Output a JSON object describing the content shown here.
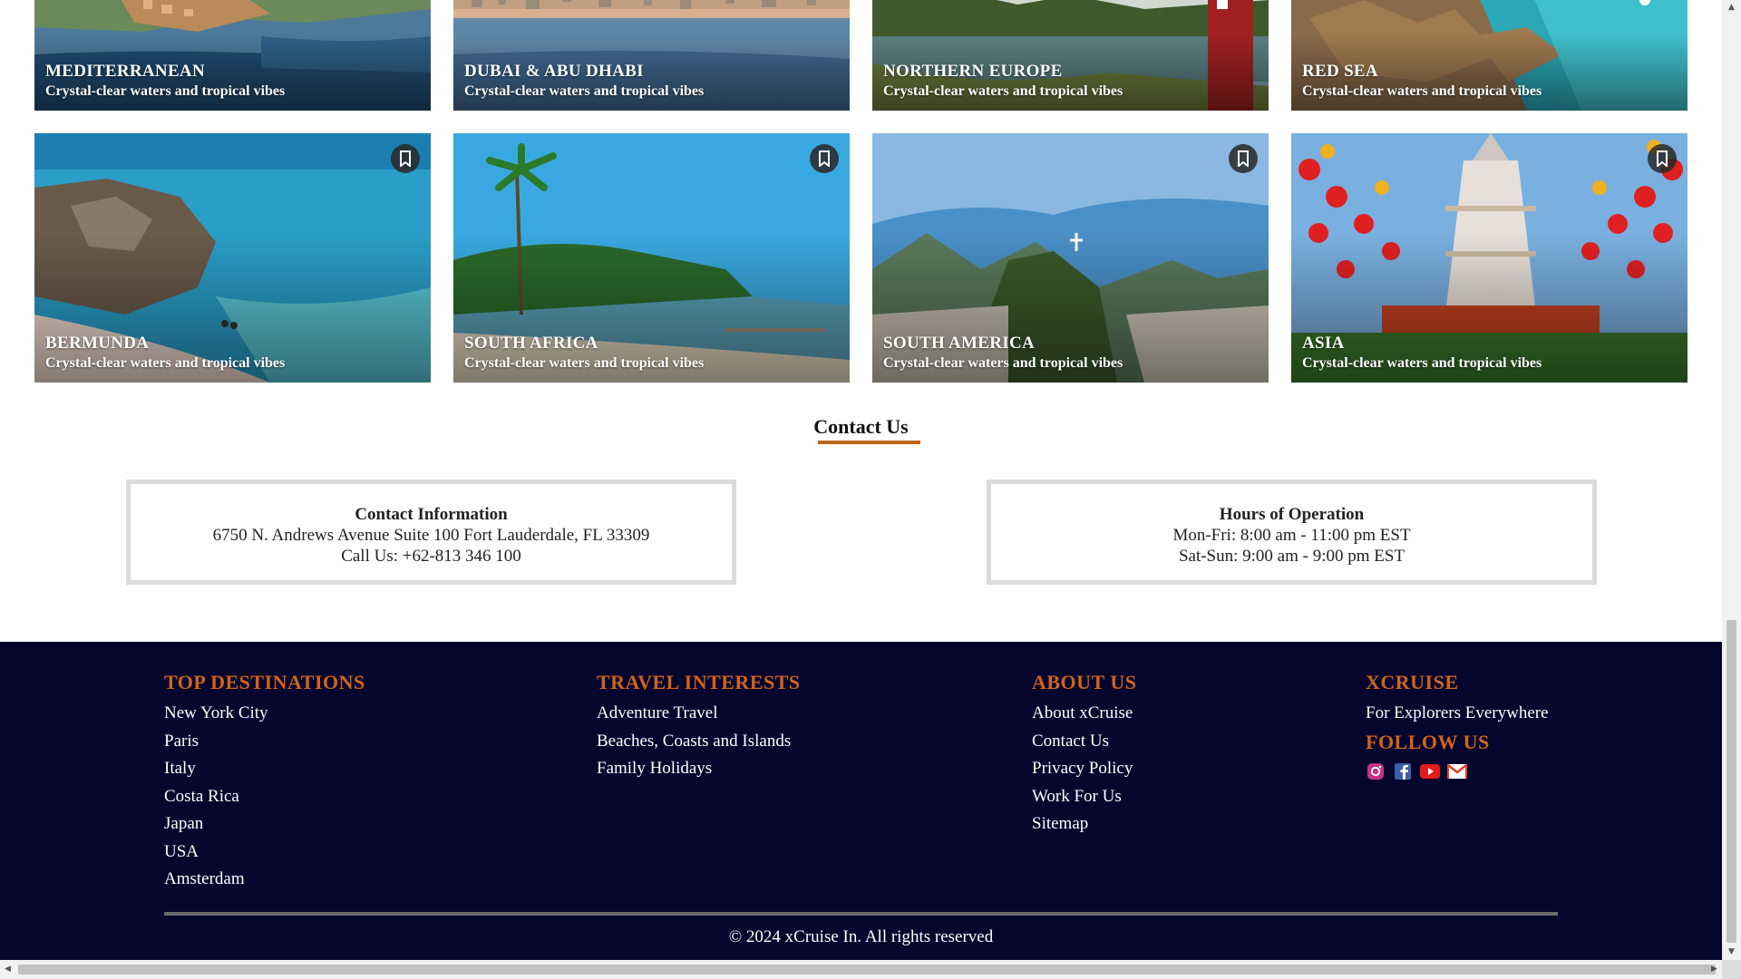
{
  "destinations_row1": [
    {
      "title": "MEDITERRANEAN",
      "subtitle": "Crystal-clear waters and tropical vibes"
    },
    {
      "title": "DUBAI & ABU DHABI",
      "subtitle": "Crystal-clear waters and tropical vibes"
    },
    {
      "title": "NORTHERN EUROPE",
      "subtitle": "Crystal-clear waters and tropical vibes"
    },
    {
      "title": "RED SEA",
      "subtitle": "Crystal-clear waters and tropical vibes"
    }
  ],
  "destinations_row2": [
    {
      "title": "BERMUNDA",
      "subtitle": "Crystal-clear waters and tropical vibes"
    },
    {
      "title": "SOUTH AFRICA",
      "subtitle": "Crystal-clear waters and tropical vibes"
    },
    {
      "title": "SOUTH AMERICA",
      "subtitle": "Crystal-clear waters and tropical vibes"
    },
    {
      "title": "ASIA",
      "subtitle": "Crystal-clear waters and tropical vibes"
    }
  ],
  "bookmark_icon": "bookmark-icon",
  "contact": {
    "title": "Contact Us",
    "info_heading": "Contact Information",
    "address": "6750 N. Andrews Avenue Suite 100 Fort Lauderdale, FL 33309",
    "phone": "Call Us: +62-813 346 100",
    "hours_heading": "Hours of Operation",
    "weekday_hours": "Mon-Fri: 8:00 am - 11:00 pm EST",
    "weekend_hours": "Sat-Sun: 9:00 am - 9:00 pm EST"
  },
  "footer": {
    "top_destinations": {
      "heading": "TOP DESTINATIONS",
      "links": [
        "New York City",
        "Paris",
        "Italy",
        "Costa Rica",
        "Japan",
        "USA",
        "Amsterdam"
      ]
    },
    "travel_interests": {
      "heading": "TRAVEL INTERESTS",
      "links": [
        "Adventure Travel",
        "Beaches, Coasts and Islands",
        "Family Holidays"
      ]
    },
    "about_us": {
      "heading": "ABOUT US",
      "links": [
        "About xCruise",
        "Contact Us",
        "Privacy Policy",
        "Work For Us",
        "Sitemap"
      ]
    },
    "brand": {
      "heading": "XCRUISE",
      "tagline": "For Explorers Everywhere",
      "follow_heading": "FOLLOW US",
      "social": [
        "instagram-icon",
        "facebook-icon",
        "youtube-icon",
        "email-icon"
      ]
    },
    "copyright": "© 2024 xCruise In. All rights reserved"
  },
  "colors": {
    "accent": "#d0641c",
    "underline": "#c0651a",
    "footer_bg": "#05052e",
    "box_border": "#dcdcdc"
  }
}
